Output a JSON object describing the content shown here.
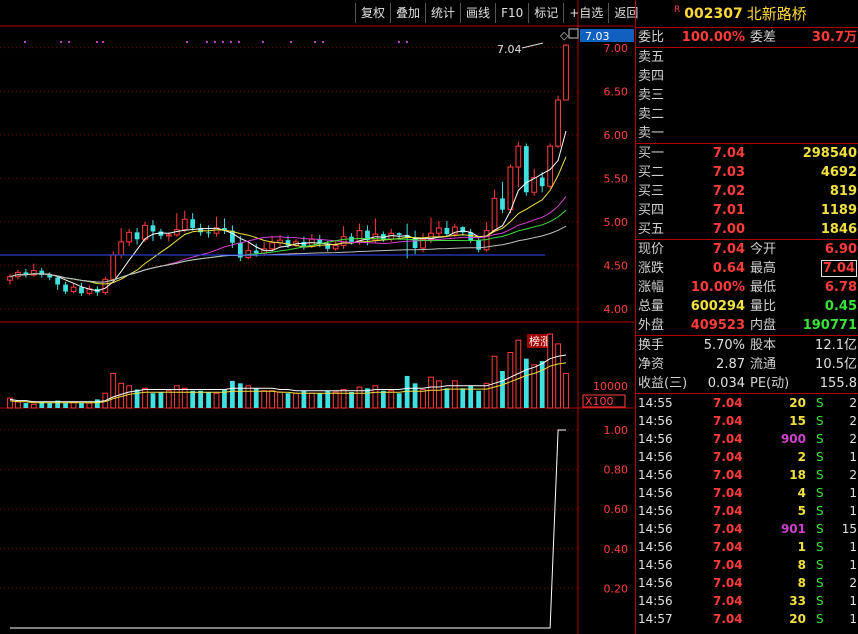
{
  "toolbar": [
    "复权",
    "叠加",
    "统计",
    "画线",
    "F10",
    "标记",
    "+自选",
    "返回"
  ],
  "colors": {
    "up": "#ff3c3c",
    "down": "#40e0e0",
    "bg": "#000000",
    "grid": "#8a0000",
    "accent": "#ffd83a"
  },
  "price_axis": {
    "ticks": [
      "7.00",
      "6.50",
      "6.00",
      "5.50",
      "5.00",
      "4.50",
      "4.00"
    ],
    "current": "7.03",
    "high_label": "7.04",
    "badge": "榜涨"
  },
  "volume_axis": {
    "tick": "10000",
    "unit": "X100"
  },
  "lower_axis": {
    "ticks": [
      "1.00",
      "0.80",
      "0.60",
      "0.40",
      "0.20"
    ]
  },
  "chart_data": {
    "type": "candlestick",
    "ylim": [
      3.85,
      7.25
    ],
    "lower_series": [
      0,
      0,
      0,
      0,
      0,
      0,
      0,
      0,
      0,
      0,
      0,
      0,
      0,
      0,
      0,
      0,
      0,
      0,
      0,
      0,
      0,
      0,
      0,
      0,
      0,
      0,
      0,
      0,
      0,
      0,
      0,
      0,
      0,
      0,
      0,
      0,
      0,
      0,
      0,
      0,
      0,
      0,
      0,
      0,
      0,
      0,
      0,
      0,
      0,
      0,
      0,
      0,
      0,
      0,
      0,
      0,
      0,
      0,
      0,
      0,
      0,
      0,
      0,
      0,
      0,
      0,
      0,
      0,
      0,
      1,
      1
    ],
    "candles": [
      [
        4.33,
        4.37,
        4.28,
        4.4
      ],
      [
        4.37,
        4.42,
        4.34,
        4.45
      ],
      [
        4.42,
        4.39,
        4.36,
        4.46
      ],
      [
        4.39,
        4.44,
        4.37,
        4.52
      ],
      [
        4.44,
        4.39,
        4.36,
        4.47
      ],
      [
        4.39,
        4.36,
        4.33,
        4.42
      ],
      [
        4.36,
        4.28,
        4.22,
        4.38
      ],
      [
        4.28,
        4.2,
        4.17,
        4.31
      ],
      [
        4.2,
        4.25,
        4.18,
        4.29
      ],
      [
        4.25,
        4.18,
        4.15,
        4.3
      ],
      [
        4.18,
        4.23,
        4.16,
        4.27
      ],
      [
        4.23,
        4.19,
        4.15,
        4.26
      ],
      [
        4.19,
        4.34,
        4.16,
        4.37
      ],
      [
        4.34,
        4.62,
        4.3,
        4.66
      ],
      [
        4.62,
        4.77,
        4.58,
        4.93
      ],
      [
        4.77,
        4.88,
        4.72,
        4.92
      ],
      [
        4.88,
        4.8,
        4.74,
        4.93
      ],
      [
        4.8,
        4.96,
        4.77,
        5.0
      ],
      [
        4.96,
        4.89,
        4.78,
        5.02
      ],
      [
        4.89,
        4.84,
        4.8,
        4.92
      ],
      [
        4.84,
        4.85,
        4.78,
        4.88
      ],
      [
        4.85,
        4.91,
        4.83,
        5.1
      ],
      [
        4.91,
        5.03,
        4.88,
        5.13
      ],
      [
        5.03,
        4.93,
        4.9,
        5.1
      ],
      [
        4.93,
        4.88,
        4.84,
        4.98
      ],
      [
        4.88,
        4.87,
        4.82,
        4.96
      ],
      [
        4.87,
        4.93,
        4.83,
        5.06
      ],
      [
        4.93,
        4.9,
        4.86,
        5.04
      ],
      [
        4.9,
        4.76,
        4.7,
        4.96
      ],
      [
        4.76,
        4.59,
        4.55,
        4.84
      ],
      [
        4.59,
        4.67,
        4.57,
        4.76
      ],
      [
        4.67,
        4.64,
        4.6,
        4.75
      ],
      [
        4.64,
        4.69,
        4.61,
        4.77
      ],
      [
        4.69,
        4.76,
        4.66,
        4.84
      ],
      [
        4.76,
        4.79,
        4.72,
        4.85
      ],
      [
        4.79,
        4.73,
        4.7,
        4.84
      ],
      [
        4.73,
        4.77,
        4.71,
        4.8
      ],
      [
        4.77,
        4.72,
        4.68,
        4.83
      ],
      [
        4.72,
        4.8,
        4.7,
        4.86
      ],
      [
        4.8,
        4.75,
        4.71,
        4.85
      ],
      [
        4.75,
        4.69,
        4.66,
        4.78
      ],
      [
        4.69,
        4.73,
        4.67,
        4.78
      ],
      [
        4.73,
        4.83,
        4.69,
        4.95
      ],
      [
        4.83,
        4.77,
        4.74,
        4.87
      ],
      [
        4.77,
        4.9,
        4.74,
        4.98
      ],
      [
        4.9,
        4.79,
        4.73,
        4.96
      ],
      [
        4.79,
        4.86,
        4.76,
        5.04
      ],
      [
        4.86,
        4.8,
        4.77,
        4.89
      ],
      [
        4.8,
        4.87,
        4.77,
        4.92
      ],
      [
        4.87,
        4.85,
        4.8,
        4.88
      ],
      [
        4.85,
        4.82,
        4.58,
        4.98
      ],
      [
        4.82,
        4.7,
        4.63,
        4.9
      ],
      [
        4.7,
        4.8,
        4.65,
        4.87
      ],
      [
        4.8,
        4.87,
        4.76,
        5.05
      ],
      [
        4.87,
        4.93,
        4.83,
        5.01
      ],
      [
        4.93,
        4.86,
        4.83,
        5.01
      ],
      [
        4.86,
        4.94,
        4.83,
        4.98
      ],
      [
        4.94,
        4.88,
        4.84,
        4.95
      ],
      [
        4.88,
        4.79,
        4.76,
        4.92
      ],
      [
        4.79,
        4.68,
        4.65,
        4.83
      ],
      [
        4.68,
        4.9,
        4.66,
        5.0
      ],
      [
        4.9,
        5.27,
        4.88,
        5.37
      ],
      [
        5.27,
        5.14,
        5.1,
        5.46
      ],
      [
        5.14,
        5.63,
        5.1,
        5.66
      ],
      [
        5.63,
        5.87,
        5.4,
        5.92
      ],
      [
        5.87,
        5.34,
        5.3,
        5.9
      ],
      [
        5.34,
        5.51,
        5.3,
        5.61
      ],
      [
        5.51,
        5.41,
        5.34,
        5.57
      ],
      [
        5.41,
        5.87,
        5.38,
        5.9
      ],
      [
        5.87,
        6.4,
        5.85,
        6.45
      ],
      [
        6.4,
        7.03,
        6.4,
        7.04
      ]
    ],
    "volumes": [
      8,
      5,
      4,
      3,
      5,
      4,
      6,
      4,
      5,
      4,
      4,
      7,
      12,
      28,
      20,
      18,
      15,
      16,
      12,
      13,
      14,
      18,
      16,
      14,
      14,
      13,
      12,
      15,
      22,
      20,
      18,
      16,
      14,
      14,
      13,
      12,
      12,
      14,
      12,
      12,
      14,
      13,
      15,
      13,
      17,
      16,
      18,
      14,
      14,
      12,
      26,
      20,
      15,
      25,
      22,
      16,
      22,
      16,
      18,
      14,
      20,
      42,
      30,
      45,
      55,
      40,
      35,
      38,
      60,
      52,
      28
    ],
    "volume_ma": [
      7,
      6,
      6,
      5,
      5,
      5,
      5,
      5,
      5,
      5,
      5,
      5,
      6,
      9,
      11,
      13,
      14,
      15,
      15,
      15,
      15,
      15,
      15,
      15,
      15,
      15,
      15,
      15,
      16,
      16,
      16,
      16,
      16,
      16,
      15,
      15,
      14,
      14,
      14,
      14,
      14,
      14,
      14,
      14,
      14,
      14,
      15,
      15,
      15,
      15,
      16,
      16,
      16,
      17,
      17,
      18,
      18,
      18,
      18,
      18,
      18,
      20,
      22,
      25,
      28,
      31,
      33,
      36,
      40,
      42,
      43
    ]
  },
  "quote": {
    "code": "002307",
    "name": "北新路桥",
    "flag": "R",
    "weibi_label": "委比",
    "weibi": "100.00%",
    "weicha_label": "委差",
    "weicha": "30.7万",
    "sell": [
      {
        "label": "卖五"
      },
      {
        "label": "卖四"
      },
      {
        "label": "卖三"
      },
      {
        "label": "卖二"
      },
      {
        "label": "卖一"
      }
    ],
    "buy": [
      {
        "label": "买一",
        "price": "7.04",
        "vol": "298540"
      },
      {
        "label": "买二",
        "price": "7.03",
        "vol": "4692"
      },
      {
        "label": "买三",
        "price": "7.02",
        "vol": "819"
      },
      {
        "label": "买四",
        "price": "7.01",
        "vol": "1189"
      },
      {
        "label": "买五",
        "price": "7.00",
        "vol": "1846"
      }
    ],
    "stats": [
      {
        "l1": "现价",
        "v1": "7.04",
        "c1": "red",
        "l2": "今开",
        "v2": "6.90",
        "c2": "red",
        "box": false
      },
      {
        "l1": "涨跌",
        "v1": "0.64",
        "c1": "red",
        "l2": "最高",
        "v2": "7.04",
        "c2": "red",
        "box": true
      },
      {
        "l1": "涨幅",
        "v1": "10.00%",
        "c1": "red",
        "l2": "最低",
        "v2": "6.78",
        "c2": "red",
        "box": false
      },
      {
        "l1": "总量",
        "v1": "600294",
        "c1": "yel",
        "l2": "量比",
        "v2": "0.45",
        "c2": "grn",
        "box": false
      },
      {
        "l1": "外盘",
        "v1": "409523",
        "c1": "red",
        "l2": "内盘",
        "v2": "190771",
        "c2": "grn",
        "box": false
      }
    ],
    "info": [
      {
        "l1": "换手",
        "v1": "5.70%",
        "l2": "股本",
        "v2": "12.1亿"
      },
      {
        "l1": "净资",
        "v1": "2.87",
        "l2": "流通",
        "v2": "10.5亿"
      },
      {
        "l1": "收益(三)",
        "v1": "0.034",
        "l2": "PE(动)",
        "v2": "155.8"
      }
    ]
  },
  "ticks": [
    {
      "time": "14:55",
      "price": "7.04",
      "vol": "20",
      "vc": "yel",
      "side": "S",
      "n": "2"
    },
    {
      "time": "14:56",
      "price": "7.04",
      "vol": "15",
      "vc": "yel",
      "side": "S",
      "n": "2"
    },
    {
      "time": "14:56",
      "price": "7.04",
      "vol": "900",
      "vc": "mag",
      "side": "S",
      "n": "2"
    },
    {
      "time": "14:56",
      "price": "7.04",
      "vol": "2",
      "vc": "yel",
      "side": "S",
      "n": "1"
    },
    {
      "time": "14:56",
      "price": "7.04",
      "vol": "18",
      "vc": "yel",
      "side": "S",
      "n": "2"
    },
    {
      "time": "14:56",
      "price": "7.04",
      "vol": "4",
      "vc": "yel",
      "side": "S",
      "n": "1"
    },
    {
      "time": "14:56",
      "price": "7.04",
      "vol": "5",
      "vc": "yel",
      "side": "S",
      "n": "1"
    },
    {
      "time": "14:56",
      "price": "7.04",
      "vol": "901",
      "vc": "mag",
      "side": "S",
      "n": "15"
    },
    {
      "time": "14:56",
      "price": "7.04",
      "vol": "1",
      "vc": "yel",
      "side": "S",
      "n": "1"
    },
    {
      "time": "14:56",
      "price": "7.04",
      "vol": "8",
      "vc": "yel",
      "side": "S",
      "n": "1"
    },
    {
      "time": "14:56",
      "price": "7.04",
      "vol": "8",
      "vc": "yel",
      "side": "S",
      "n": "2"
    },
    {
      "time": "14:56",
      "price": "7.04",
      "vol": "33",
      "vc": "yel",
      "side": "S",
      "n": "1"
    },
    {
      "time": "14:57",
      "price": "7.04",
      "vol": "20",
      "vc": "yel",
      "side": "S",
      "n": "1"
    }
  ]
}
